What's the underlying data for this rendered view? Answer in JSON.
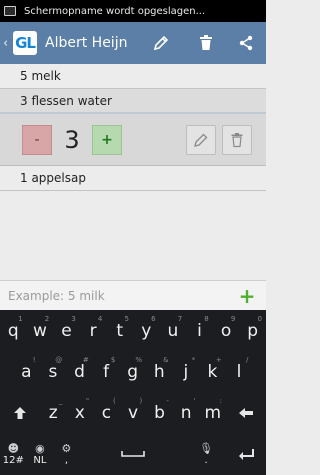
{
  "status": {
    "text": "Schermopname wordt opgeslagen..."
  },
  "actionbar": {
    "logo": "GL",
    "title": "Albert Heijn",
    "back": "‹"
  },
  "list": {
    "items_top": [
      "5 melk",
      "3 flessen water"
    ],
    "editor": {
      "minus": "-",
      "quantity": "3",
      "plus": "+"
    },
    "items_bottom": [
      "1 appelsap"
    ]
  },
  "input": {
    "placeholder": "Example: 5 milk",
    "value": "",
    "add": "+"
  },
  "keyboard": {
    "row1": [
      [
        "q",
        "1"
      ],
      [
        "w",
        "2"
      ],
      [
        "e",
        "3"
      ],
      [
        "r",
        "4"
      ],
      [
        "t",
        "5"
      ],
      [
        "y",
        "6"
      ],
      [
        "u",
        "7"
      ],
      [
        "i",
        "8"
      ],
      [
        "o",
        "9"
      ],
      [
        "p",
        "0"
      ]
    ],
    "row2": [
      [
        "a",
        "!"
      ],
      [
        "s",
        "@"
      ],
      [
        "d",
        "#"
      ],
      [
        "f",
        "$"
      ],
      [
        "g",
        "%"
      ],
      [
        "h",
        "&"
      ],
      [
        "j",
        "*"
      ],
      [
        "k",
        "+"
      ],
      [
        "l",
        "/"
      ]
    ],
    "row3": [
      [
        "z",
        "_"
      ],
      [
        "x",
        "\""
      ],
      [
        "c",
        "("
      ],
      [
        "v",
        ")"
      ],
      [
        "b",
        "-"
      ],
      [
        "n",
        "'"
      ],
      [
        "m",
        ":"
      ]
    ],
    "row4_left": [
      "12#",
      "NL"
    ],
    "row4_comma": ",",
    "row4_mic_sub": "."
  }
}
